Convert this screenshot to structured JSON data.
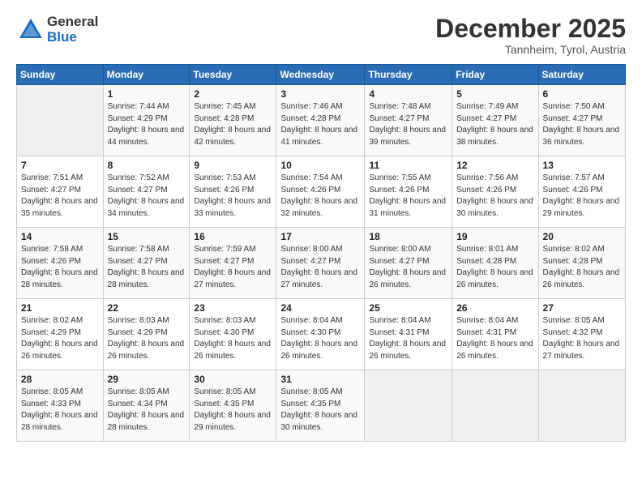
{
  "header": {
    "logo_general": "General",
    "logo_blue": "Blue",
    "month": "December 2025",
    "location": "Tannheim, Tyrol, Austria"
  },
  "days_of_week": [
    "Sunday",
    "Monday",
    "Tuesday",
    "Wednesday",
    "Thursday",
    "Friday",
    "Saturday"
  ],
  "weeks": [
    [
      {
        "day": "",
        "sunrise": "",
        "sunset": "",
        "daylight": ""
      },
      {
        "day": "1",
        "sunrise": "Sunrise: 7:44 AM",
        "sunset": "Sunset: 4:29 PM",
        "daylight": "Daylight: 8 hours and 44 minutes."
      },
      {
        "day": "2",
        "sunrise": "Sunrise: 7:45 AM",
        "sunset": "Sunset: 4:28 PM",
        "daylight": "Daylight: 8 hours and 42 minutes."
      },
      {
        "day": "3",
        "sunrise": "Sunrise: 7:46 AM",
        "sunset": "Sunset: 4:28 PM",
        "daylight": "Daylight: 8 hours and 41 minutes."
      },
      {
        "day": "4",
        "sunrise": "Sunrise: 7:48 AM",
        "sunset": "Sunset: 4:27 PM",
        "daylight": "Daylight: 8 hours and 39 minutes."
      },
      {
        "day": "5",
        "sunrise": "Sunrise: 7:49 AM",
        "sunset": "Sunset: 4:27 PM",
        "daylight": "Daylight: 8 hours and 38 minutes."
      },
      {
        "day": "6",
        "sunrise": "Sunrise: 7:50 AM",
        "sunset": "Sunset: 4:27 PM",
        "daylight": "Daylight: 8 hours and 36 minutes."
      }
    ],
    [
      {
        "day": "7",
        "sunrise": "Sunrise: 7:51 AM",
        "sunset": "Sunset: 4:27 PM",
        "daylight": "Daylight: 8 hours and 35 minutes."
      },
      {
        "day": "8",
        "sunrise": "Sunrise: 7:52 AM",
        "sunset": "Sunset: 4:27 PM",
        "daylight": "Daylight: 8 hours and 34 minutes."
      },
      {
        "day": "9",
        "sunrise": "Sunrise: 7:53 AM",
        "sunset": "Sunset: 4:26 PM",
        "daylight": "Daylight: 8 hours and 33 minutes."
      },
      {
        "day": "10",
        "sunrise": "Sunrise: 7:54 AM",
        "sunset": "Sunset: 4:26 PM",
        "daylight": "Daylight: 8 hours and 32 minutes."
      },
      {
        "day": "11",
        "sunrise": "Sunrise: 7:55 AM",
        "sunset": "Sunset: 4:26 PM",
        "daylight": "Daylight: 8 hours and 31 minutes."
      },
      {
        "day": "12",
        "sunrise": "Sunrise: 7:56 AM",
        "sunset": "Sunset: 4:26 PM",
        "daylight": "Daylight: 8 hours and 30 minutes."
      },
      {
        "day": "13",
        "sunrise": "Sunrise: 7:57 AM",
        "sunset": "Sunset: 4:26 PM",
        "daylight": "Daylight: 8 hours and 29 minutes."
      }
    ],
    [
      {
        "day": "14",
        "sunrise": "Sunrise: 7:58 AM",
        "sunset": "Sunset: 4:26 PM",
        "daylight": "Daylight: 8 hours and 28 minutes."
      },
      {
        "day": "15",
        "sunrise": "Sunrise: 7:58 AM",
        "sunset": "Sunset: 4:27 PM",
        "daylight": "Daylight: 8 hours and 28 minutes."
      },
      {
        "day": "16",
        "sunrise": "Sunrise: 7:59 AM",
        "sunset": "Sunset: 4:27 PM",
        "daylight": "Daylight: 8 hours and 27 minutes."
      },
      {
        "day": "17",
        "sunrise": "Sunrise: 8:00 AM",
        "sunset": "Sunset: 4:27 PM",
        "daylight": "Daylight: 8 hours and 27 minutes."
      },
      {
        "day": "18",
        "sunrise": "Sunrise: 8:00 AM",
        "sunset": "Sunset: 4:27 PM",
        "daylight": "Daylight: 8 hours and 26 minutes."
      },
      {
        "day": "19",
        "sunrise": "Sunrise: 8:01 AM",
        "sunset": "Sunset: 4:28 PM",
        "daylight": "Daylight: 8 hours and 26 minutes."
      },
      {
        "day": "20",
        "sunrise": "Sunrise: 8:02 AM",
        "sunset": "Sunset: 4:28 PM",
        "daylight": "Daylight: 8 hours and 26 minutes."
      }
    ],
    [
      {
        "day": "21",
        "sunrise": "Sunrise: 8:02 AM",
        "sunset": "Sunset: 4:29 PM",
        "daylight": "Daylight: 8 hours and 26 minutes."
      },
      {
        "day": "22",
        "sunrise": "Sunrise: 8:03 AM",
        "sunset": "Sunset: 4:29 PM",
        "daylight": "Daylight: 8 hours and 26 minutes."
      },
      {
        "day": "23",
        "sunrise": "Sunrise: 8:03 AM",
        "sunset": "Sunset: 4:30 PM",
        "daylight": "Daylight: 8 hours and 26 minutes."
      },
      {
        "day": "24",
        "sunrise": "Sunrise: 8:04 AM",
        "sunset": "Sunset: 4:30 PM",
        "daylight": "Daylight: 8 hours and 26 minutes."
      },
      {
        "day": "25",
        "sunrise": "Sunrise: 8:04 AM",
        "sunset": "Sunset: 4:31 PM",
        "daylight": "Daylight: 8 hours and 26 minutes."
      },
      {
        "day": "26",
        "sunrise": "Sunrise: 8:04 AM",
        "sunset": "Sunset: 4:31 PM",
        "daylight": "Daylight: 8 hours and 26 minutes."
      },
      {
        "day": "27",
        "sunrise": "Sunrise: 8:05 AM",
        "sunset": "Sunset: 4:32 PM",
        "daylight": "Daylight: 8 hours and 27 minutes."
      }
    ],
    [
      {
        "day": "28",
        "sunrise": "Sunrise: 8:05 AM",
        "sunset": "Sunset: 4:33 PM",
        "daylight": "Daylight: 8 hours and 28 minutes."
      },
      {
        "day": "29",
        "sunrise": "Sunrise: 8:05 AM",
        "sunset": "Sunset: 4:34 PM",
        "daylight": "Daylight: 8 hours and 28 minutes."
      },
      {
        "day": "30",
        "sunrise": "Sunrise: 8:05 AM",
        "sunset": "Sunset: 4:35 PM",
        "daylight": "Daylight: 8 hours and 29 minutes."
      },
      {
        "day": "31",
        "sunrise": "Sunrise: 8:05 AM",
        "sunset": "Sunset: 4:35 PM",
        "daylight": "Daylight: 8 hours and 30 minutes."
      },
      {
        "day": "",
        "sunrise": "",
        "sunset": "",
        "daylight": ""
      },
      {
        "day": "",
        "sunrise": "",
        "sunset": "",
        "daylight": ""
      },
      {
        "day": "",
        "sunrise": "",
        "sunset": "",
        "daylight": ""
      }
    ]
  ]
}
